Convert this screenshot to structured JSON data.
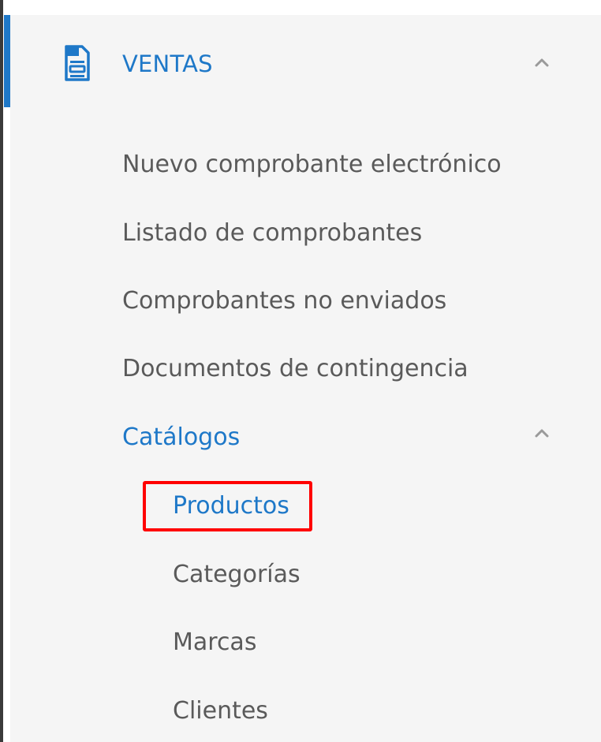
{
  "menu": {
    "section_title": "VENTAS",
    "section_icon": "document-icon",
    "items": [
      {
        "label": "Nuevo comprobante electrónico"
      },
      {
        "label": "Listado de comprobantes"
      },
      {
        "label": "Comprobantes no enviados"
      },
      {
        "label": "Documentos de contingencia"
      }
    ],
    "submenu": {
      "label": "Catálogos",
      "items": [
        {
          "label": "Productos",
          "highlighted": true
        },
        {
          "label": "Categorías"
        },
        {
          "label": "Marcas"
        },
        {
          "label": "Clientes"
        }
      ]
    }
  },
  "colors": {
    "accent": "#1e78c8",
    "text": "#5a5a5a",
    "background": "#f5f5f5",
    "highlight_border": "#ff0000"
  }
}
